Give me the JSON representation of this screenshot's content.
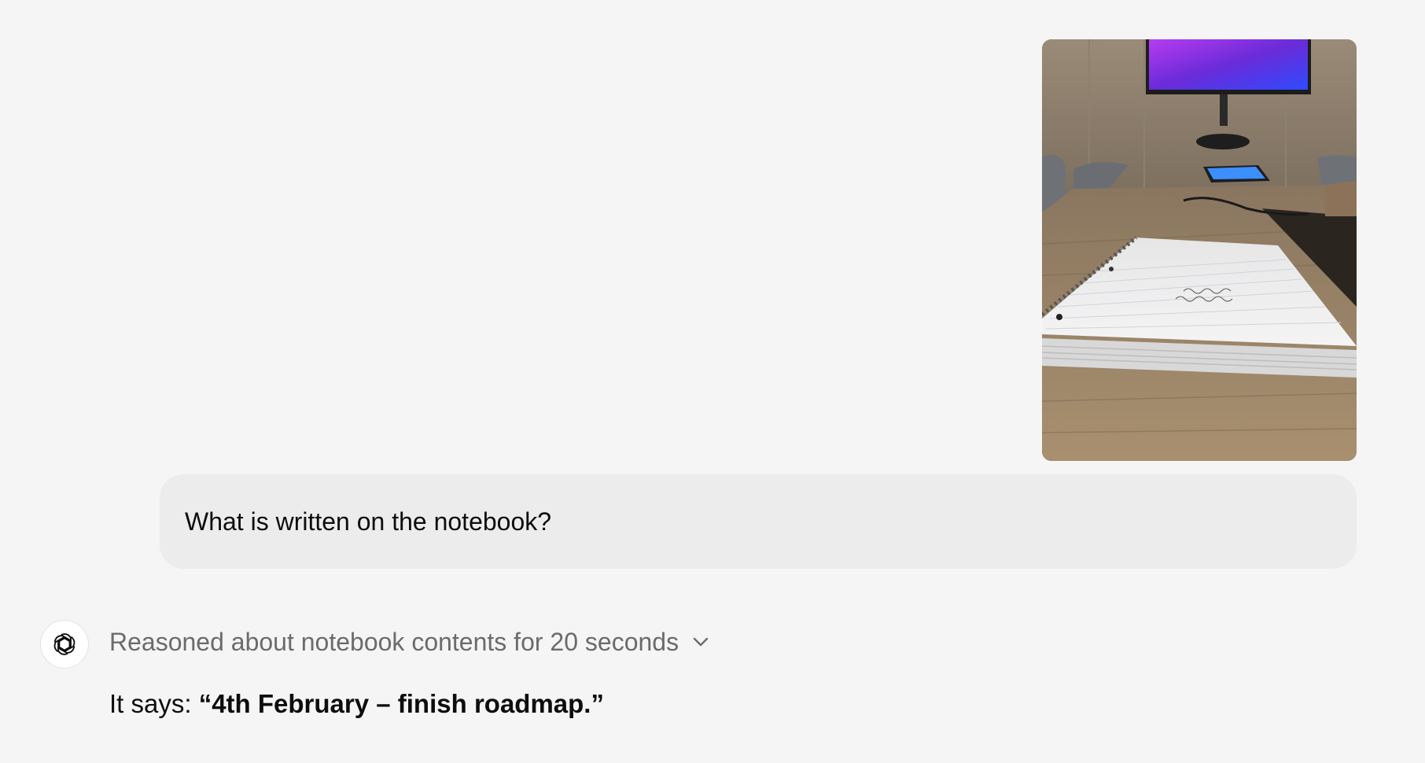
{
  "conversation": {
    "user_message": {
      "attachment_icon": "photo-of-notebook-on-conference-table",
      "text": "What is written on the notebook?"
    },
    "assistant_message": {
      "avatar_icon": "openai-logo-icon",
      "reasoning_summary": "Reasoned about notebook contents for 20 seconds",
      "reasoning_toggle_icon": "chevron-down-icon",
      "answer_prefix": "It says: ",
      "answer_quote": "“4th February – finish roadmap.”"
    }
  },
  "colors": {
    "background": "#f5f5f5",
    "user_bubble": "#ececec",
    "muted_text": "#6b6b6b",
    "text": "#0d0d0d"
  }
}
